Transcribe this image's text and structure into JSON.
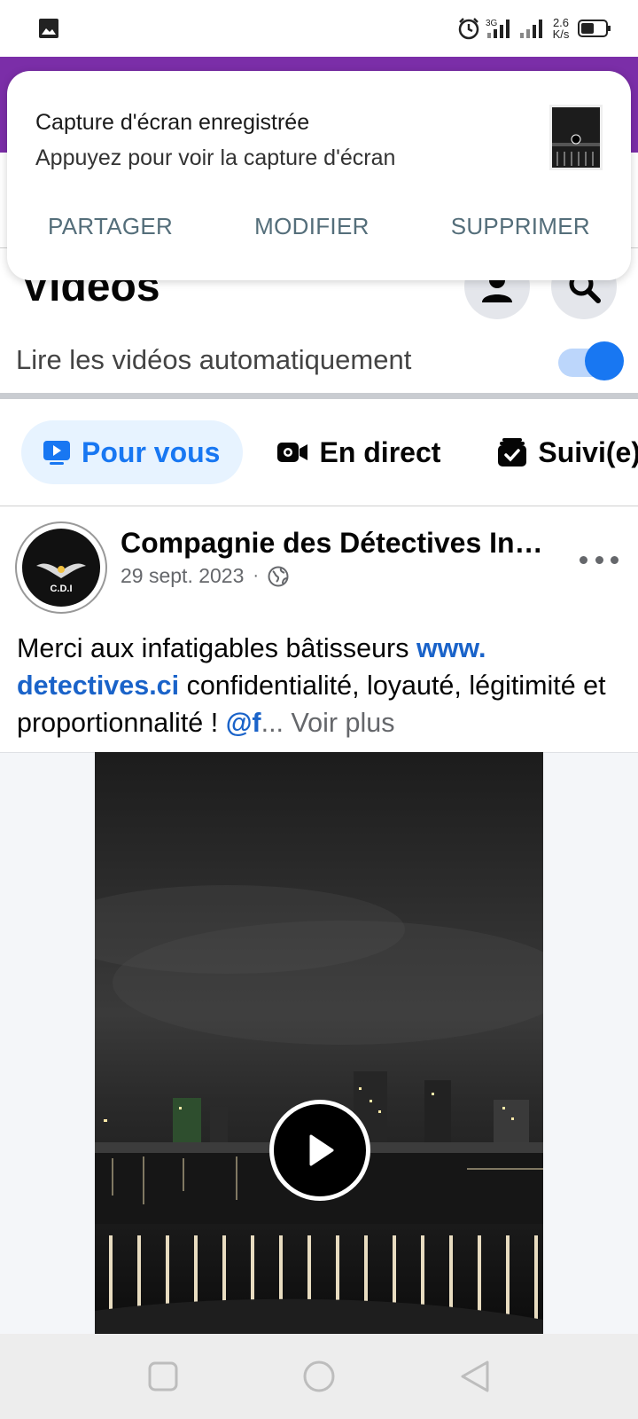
{
  "status_bar": {
    "net_speed_value": "2.6",
    "net_speed_unit": "K/s",
    "network_type": "3G",
    "icons": [
      "gallery-icon",
      "alarm-icon",
      "signal-icon",
      "battery-icon"
    ]
  },
  "notification": {
    "title": "Capture d'écran enregistrée",
    "text": "Appuyez pour voir la capture d'écran",
    "actions": {
      "share": "PARTAGER",
      "edit": "MODIFIER",
      "delete": "SUPPRIMER"
    }
  },
  "header": {
    "title": "Vidéos",
    "autoplay_label": "Lire les vidéos automatiquement",
    "autoplay_enabled": true
  },
  "tabs": {
    "for_you": "Pour vous",
    "live": "En direct",
    "following": "Suivi(e)"
  },
  "post": {
    "author": "Compagnie des Détectives Indépendants",
    "date": "29 sept. 2023",
    "separator": "·",
    "avatar_text": "C.D.I",
    "text_before_link": "Merci aux infatigables bâtisseurs ",
    "link": "www. detectives.ci",
    "text_after_link": "  confidentialité, loyauté, légitimité et proportionnalité  ! ",
    "mention": "@f",
    "see_more": "... Voir plus"
  },
  "colors": {
    "accent": "#1877f2",
    "purple_header": "#7b2ea8",
    "link": "#1a63c9"
  }
}
